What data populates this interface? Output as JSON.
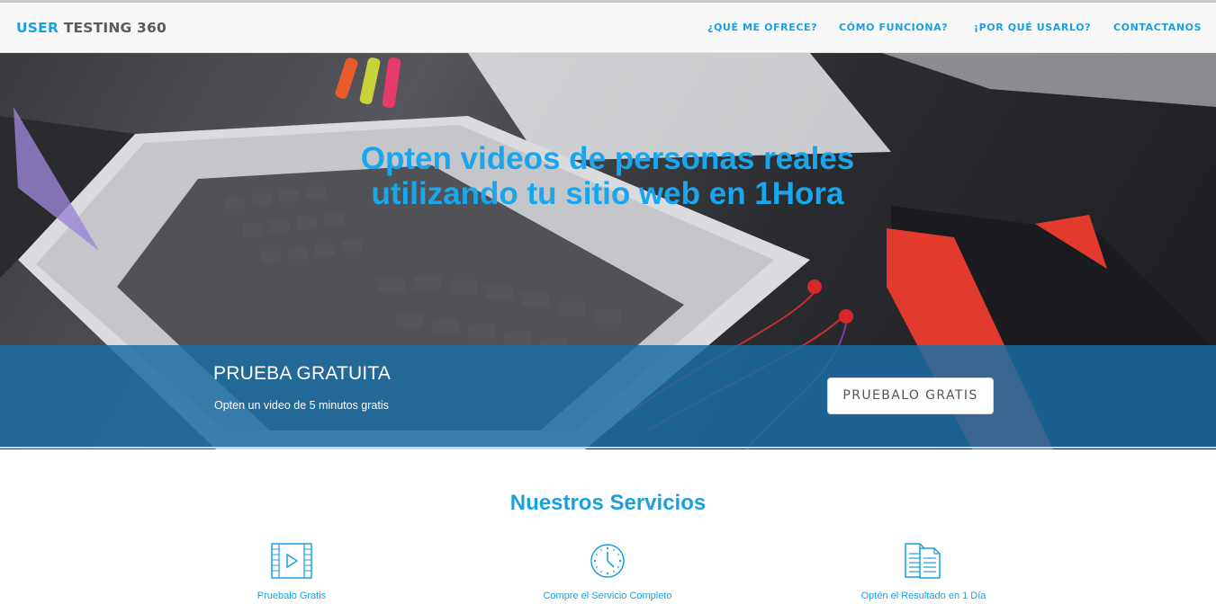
{
  "brand": {
    "part1": "USER",
    "part2": "TESTING 360",
    "accent": "#1aa0e0"
  },
  "nav": [
    {
      "label": "¿QUÉ ME OFRECE?"
    },
    {
      "label": "CÓMO FUNCIONA?"
    },
    {
      "label": "¡POR QUÉ USARLO?"
    },
    {
      "label": "CONTACTANOS"
    }
  ],
  "hero": {
    "line1": "Opten videos de personas reales",
    "line2": "utilizando tu sitio web en 1Hora"
  },
  "trial": {
    "title": "PRUEBA GRATUITA",
    "subtitle": "Opten un video de 5 minutos gratis",
    "button": "PRUEBALO GRATIS",
    "band_color": "#1a6ea5"
  },
  "services": {
    "title": "Nuestros Servicios",
    "items": [
      {
        "icon": "video-icon",
        "label": "Pruebalo Gratis"
      },
      {
        "icon": "clock-icon",
        "label": "Compre el Servicio Completo"
      },
      {
        "icon": "documents-icon",
        "label": "Optén el Resultado en 1 Día"
      }
    ]
  }
}
